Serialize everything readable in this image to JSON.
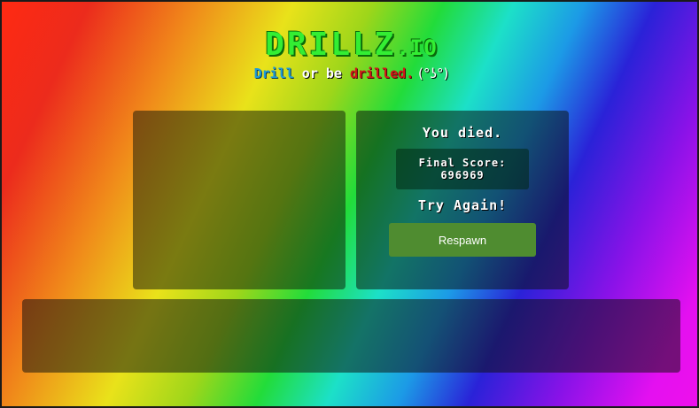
{
  "logo": {
    "main": "DRILLZ",
    "tld": ".IO"
  },
  "tagline": {
    "word1": "Drill",
    "word2": " or be ",
    "word3": "drilled.",
    "face": " (°ʖ°)"
  },
  "death_panel": {
    "title": "You died.",
    "score_label": "Final Score:",
    "score_value": "696969",
    "try_again": "Try Again!",
    "respawn_label": "Respawn"
  },
  "colors": {
    "logo_green": "#33ee33",
    "drill_blue": "#1e9bd7",
    "drilled_red": "#d01818",
    "respawn_button": "#4f8c30"
  }
}
